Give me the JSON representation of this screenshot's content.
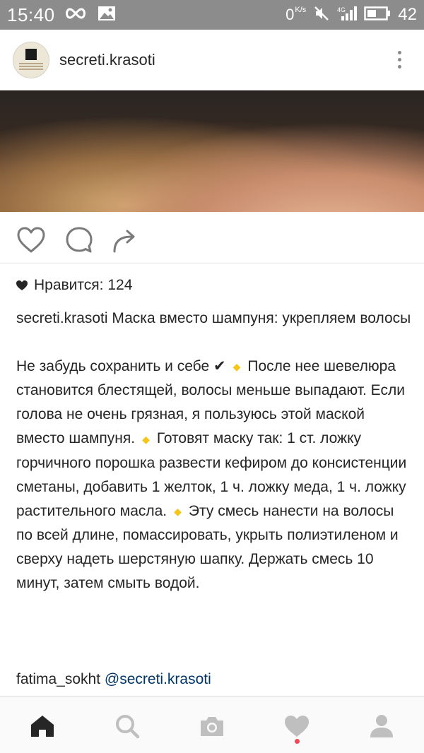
{
  "status_bar": {
    "time": "15:40",
    "speed_value": "0",
    "speed_unit": "K/s",
    "network": "4G",
    "battery_percent": "42"
  },
  "post": {
    "username": "secreti.krasoti",
    "likes_text": "Нравится: 124",
    "caption_user": "secreti.krasoti",
    "caption_title": "Маска вместо шампуня: укрепляем волосы",
    "caption_part1": "Не забудь сохранить и себе ✔",
    "caption_part2": "После нее шевелюра становится блестящей, волосы меньше выпадают. Если голова не очень грязная, я пользуюсь этой маской вместо шампуня.",
    "caption_part3": "Готовят маску так: 1 ст. ложку горчичного порошка развести кефиром до консистенции сметаны, добавить 1 желток, 1 ч. ложку меда, 1 ч. ложку растительного масла.",
    "caption_part4": "Эту смесь нанести на волосы по всей длине, помассировать, укрыть полиэтиленом и сверху надеть шерстяную шапку. Держать смесь 10 минут, затем смыть водой.",
    "comment_user": "fatima_sokht",
    "comment_mention": "@secreti.krasoti"
  },
  "icons": {
    "like": "heart-outline-icon",
    "comment": "comment-bubble-icon",
    "share": "share-arrow-icon",
    "nav": [
      "home-icon",
      "search-icon",
      "camera-icon",
      "heart-icon",
      "profile-icon"
    ]
  },
  "colors": {
    "status_bar": "#8c8c8c",
    "diamond": "#f5c518",
    "mention": "#003569",
    "notification_dot": "#ed4956"
  }
}
